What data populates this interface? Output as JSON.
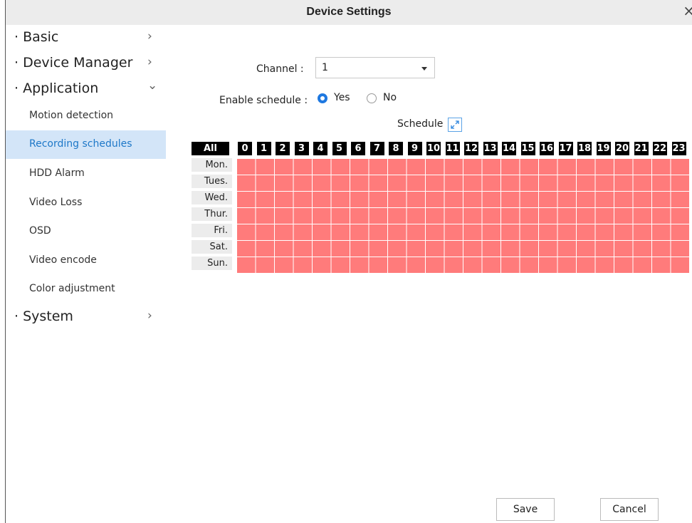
{
  "window": {
    "title": "Device Settings",
    "close_glyph": "×"
  },
  "sidebar": {
    "groups": [
      {
        "label": "· Basic",
        "chevron": "›"
      },
      {
        "label": "· Device Manager",
        "chevron": "›"
      },
      {
        "label": "· Application",
        "chevron": "⌄"
      },
      {
        "label": "· System",
        "chevron": "›"
      }
    ],
    "items": [
      {
        "label": "Motion detection"
      },
      {
        "label": "Recording schedules",
        "active": true
      },
      {
        "label": "HDD Alarm"
      },
      {
        "label": "Video Loss"
      },
      {
        "label": "OSD"
      },
      {
        "label": "Video encode"
      },
      {
        "label": "Color adjustment"
      }
    ]
  },
  "form": {
    "channel_label": "Channel :",
    "channel_value": "1",
    "enable_label": "Enable schedule :",
    "enable_yes": "Yes",
    "enable_no": "No",
    "enable_selected": "Yes",
    "schedule_label": "Schedule"
  },
  "schedule": {
    "all_label": "All",
    "hours": [
      "0",
      "1",
      "2",
      "3",
      "4",
      "5",
      "6",
      "7",
      "8",
      "9",
      "10",
      "11",
      "12",
      "13",
      "14",
      "15",
      "16",
      "17",
      "18",
      "19",
      "20",
      "21",
      "22",
      "23"
    ],
    "days": [
      "Mon.",
      "Tues.",
      "Wed.",
      "Thur.",
      "Fri.",
      "Sat.",
      "Sun."
    ],
    "all_cells_selected": true,
    "selected_color": "#ff7b7b"
  },
  "buttons": {
    "save": "Save",
    "cancel": "Cancel"
  },
  "colors": {
    "accent": "#1e78c8",
    "active_bg": "#d3e5f8",
    "titlebar_bg": "#ececec"
  }
}
